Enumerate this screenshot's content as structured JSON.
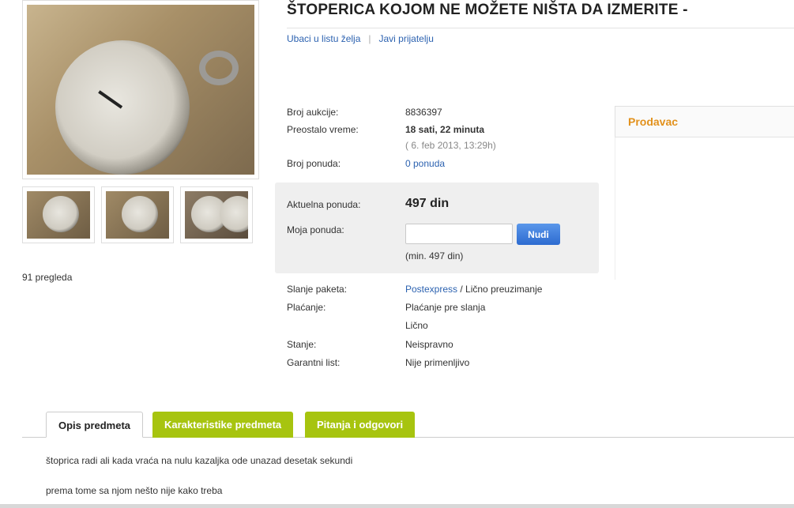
{
  "title": "ŠTOPERICA KOJOM NE MOŽETE NIŠTA DA IZMERITE -",
  "links": {
    "wishlist": "Ubaci u listu želja",
    "tell_friend": "Javi prijatelju"
  },
  "views": "91 pregleda",
  "details": {
    "auction_label": "Broj aukcije:",
    "auction_value": "8836397",
    "time_label": "Preostalo vreme:",
    "time_value": "18 sati, 22 minuta",
    "time_end": "( 6. feb 2013, 13:29h)",
    "bids_label": "Broj ponuda:",
    "bids_value": "0 ponuda"
  },
  "bid": {
    "current_label": "Aktuelna ponuda:",
    "current_value": "497 din",
    "my_label": "Moja ponuda:",
    "input_value": "",
    "button": "Nudi",
    "min": "(min. 497 din)"
  },
  "shipping": {
    "label": "Slanje paketa:",
    "option1": "Postexpress",
    "sep": " / ",
    "option2": "Lično preuzimanje",
    "payment_label": "Plaćanje:",
    "payment1": "Plaćanje pre slanja",
    "payment2": "Lično",
    "condition_label": "Stanje:",
    "condition_value": "Neispravno",
    "warranty_label": "Garantni list:",
    "warranty_value": "Nije primenljivo"
  },
  "seller": {
    "title": "Prodavac"
  },
  "tabs": [
    "Opis predmeta",
    "Karakteristike predmeta",
    "Pitanja i odgovori"
  ],
  "description": {
    "line1": "štoprica radi ali kada vraća na nulu kazaljka ode unazad desetak sekundi",
    "line2": "prema tome sa njom nešto nije kako treba"
  },
  "colors": {
    "accent_link": "#2c62b0",
    "tab_green": "#a7c40f",
    "seller_orange": "#e2911c",
    "button_blue": "#3b7ddc"
  }
}
